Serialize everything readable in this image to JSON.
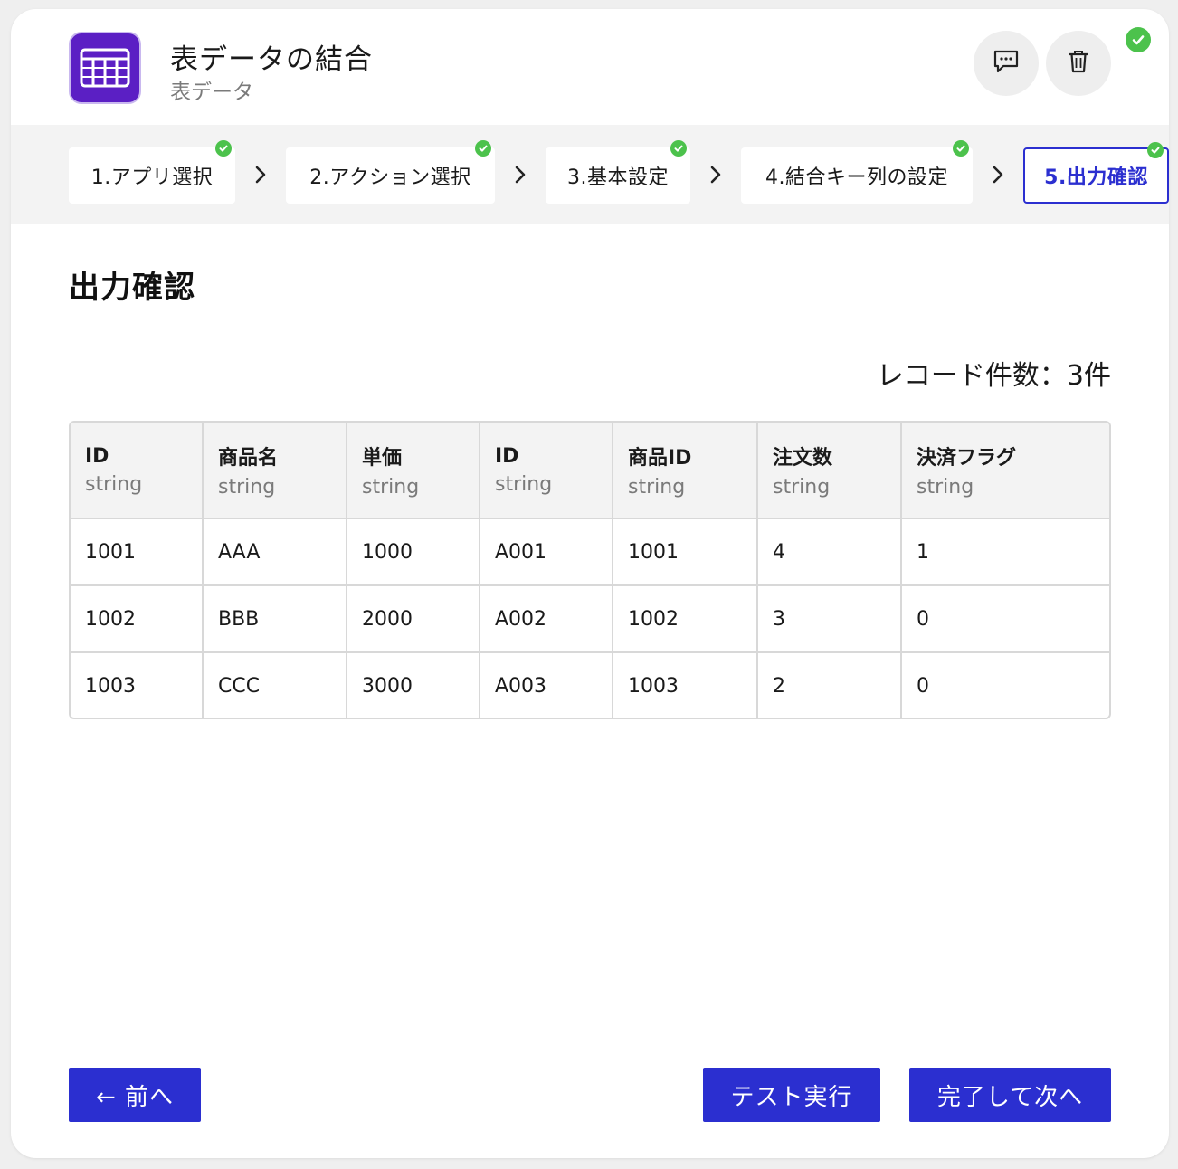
{
  "header": {
    "title": "表データの結合",
    "subtitle": "表データ",
    "app_icon": "table-icon",
    "comment_icon": "comment-icon",
    "delete_icon": "trash-icon",
    "status_icon": "check-circle-icon"
  },
  "colors": {
    "accent": "#2b2fd0",
    "app_icon_bg": "#5b1fc4",
    "success": "#4cc24c"
  },
  "stepper": {
    "steps": [
      {
        "label": "1.アプリ選択",
        "completed": true,
        "active": false
      },
      {
        "label": "2.アクション選択",
        "completed": true,
        "active": false
      },
      {
        "label": "3.基本設定",
        "completed": true,
        "active": false
      },
      {
        "label": "4.結合キー列の設定",
        "completed": true,
        "active": false
      },
      {
        "label": "5.出力確認",
        "completed": true,
        "active": true
      }
    ]
  },
  "main": {
    "title": "出力確認",
    "record_count": "レコード件数：3件"
  },
  "table": {
    "columns": [
      {
        "name": "ID",
        "type": "string"
      },
      {
        "name": "商品名",
        "type": "string"
      },
      {
        "name": "単価",
        "type": "string"
      },
      {
        "name": "ID",
        "type": "string"
      },
      {
        "name": "商品ID",
        "type": "string"
      },
      {
        "name": "注文数",
        "type": "string"
      },
      {
        "name": "決済フラグ",
        "type": "string"
      }
    ],
    "rows": [
      [
        "1001",
        "AAA",
        "1000",
        "A001",
        "1001",
        "4",
        "1"
      ],
      [
        "1002",
        "BBB",
        "2000",
        "A002",
        "1002",
        "3",
        "0"
      ],
      [
        "1003",
        "CCC",
        "3000",
        "A003",
        "1003",
        "2",
        "0"
      ]
    ]
  },
  "footer": {
    "prev_label": "← 前へ",
    "test_label": "テスト実行",
    "next_label": "完了して次へ"
  }
}
